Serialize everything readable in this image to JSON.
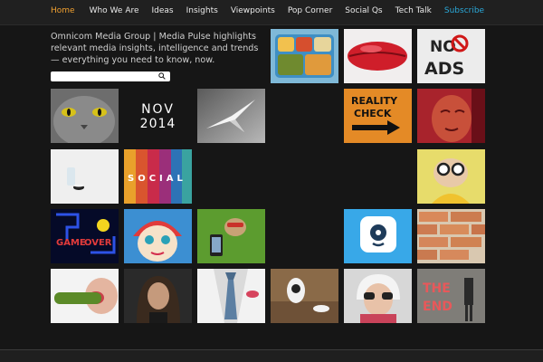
{
  "nav": {
    "items": [
      "Home",
      "Who We Are",
      "Ideas",
      "Insights",
      "Viewpoints",
      "Pop Corner",
      "Social Qs",
      "Tech Talk",
      "Subscribe"
    ],
    "active": "Home",
    "colors": {
      "active": "#f0a030",
      "subscribe": "#2aa8d8",
      "default": "#e8e8e8"
    }
  },
  "intro": {
    "text": "Omnicom Media Group | Media Pulse highlights relevant media insights, intelligence and trends — everything you need to know, now."
  },
  "search": {
    "value": "",
    "icon": "search-icon"
  },
  "date_tile": {
    "month": "NOV",
    "year": "2014"
  },
  "tiles": {
    "no_ads": [
      "NO",
      "ADS"
    ],
    "reality_check": [
      "REALITY",
      "CHECK"
    ],
    "social": "SOCIAL",
    "game_over": [
      "GAME",
      "OVER"
    ],
    "the_end": [
      "THE",
      "END"
    ]
  }
}
